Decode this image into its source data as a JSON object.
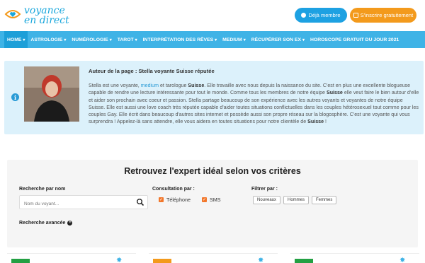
{
  "header": {
    "logo_line1": "voyance",
    "logo_line2": "en direct",
    "member_button": "Déjà membre",
    "signup_button": "S'inscrire gratuitement"
  },
  "nav": {
    "items": [
      {
        "label": "HOME",
        "caret": true
      },
      {
        "label": "ASTROLOGIE",
        "caret": true
      },
      {
        "label": "NUMÉROLOGIE",
        "caret": true
      },
      {
        "label": "TAROT",
        "caret": true
      },
      {
        "label": "INTERPRÉTATION DES RÊVES",
        "caret": true
      },
      {
        "label": "MEDIUM",
        "caret": true
      },
      {
        "label": "RÉCUPÉRER SON EX",
        "caret": true
      },
      {
        "label": "HOROSCOPE GRATUIT DU JOUR 2021",
        "caret": false
      }
    ]
  },
  "author": {
    "title": "Auteur de la page : Stella voyante Suisse réputée",
    "p_before_medium": "Stella est une voyante, ",
    "medium_link": "medium",
    "p_after_medium": " et tarologue ",
    "suisse_1": "Suisse",
    "p_part2": ". Elle travaille avec nous depuis la naissance du site. C'est en plus une excellente blogueuse capable de rendre une lecture intéressante pour tout le monde. Comme tous les membres de notre équipe ",
    "suisse_2": "Suisse",
    "p_part3": " elle veut faire le bien autour d'elle et aider son prochain avec coeur et passion. Stella partage beaucoup de son expérience avec les autres voyants et voyantes de notre équipe Suisse. Elle est aussi une love coach très réputée capable d'aider toutes situations conflictuelles dans les couples hétérosexuel tout comme pour les couples Gay.  Elle écrit dans beaucoup d'autres sites internet et possède aussi son propre réseau sur la blogosphère. C'est une voyante qui vous surprendra ! Appelez-là sans attendre, elle vous aidera en toutes situations pour notre clientèle de ",
    "suisse_3": "Suisse",
    "p_end": " !"
  },
  "finder": {
    "title": "Retrouvez l'expert idéal selon vos critères",
    "search_label": "Recherche par nom",
    "search_placeholder": "Nom du voyant...",
    "consult_label": "Consultation par :",
    "phone_option": "Téléphone",
    "sms_option": "SMS",
    "filter_label": "Filtrer par :",
    "filter_new": "Nouveaux",
    "filter_men": "Hommes",
    "filter_women": "Femmes",
    "advanced_search": "Recherche avancée"
  },
  "colors": {
    "brand_blue": "#3fb3e6",
    "nav_active": "#1d9fd8",
    "signup_orange": "#f39a1c",
    "member_blue": "#1da1e2",
    "checkbox_orange": "#f2772b",
    "author_bg": "#dcf1fb"
  }
}
